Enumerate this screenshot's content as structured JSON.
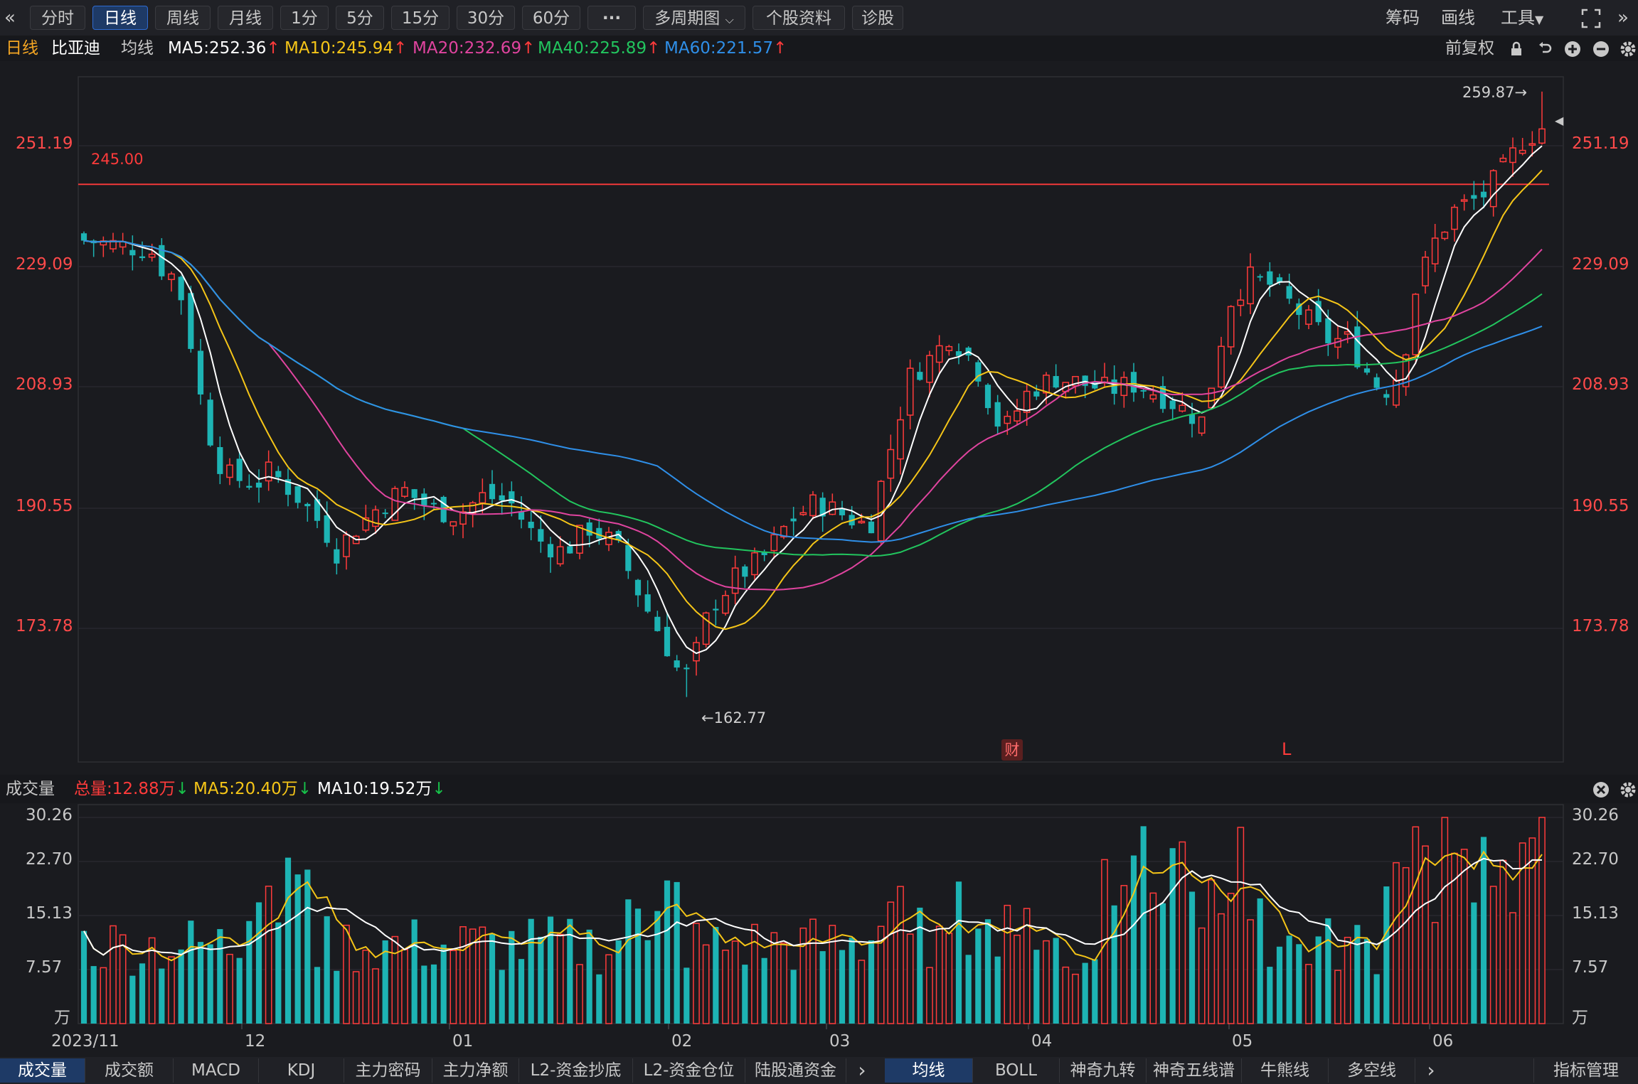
{
  "toolbar": {
    "back_icon": "«",
    "periods": [
      "分时",
      "日线",
      "周线",
      "月线",
      "1分",
      "5分",
      "15分",
      "30分",
      "60分"
    ],
    "active_period": "日线",
    "more_label": "···",
    "multi_period": "多周期图",
    "stock_info": "个股资料",
    "diagnose": "诊股",
    "chips": "筹码",
    "draw": "画线",
    "tools": "工具",
    "expand_icon": "expand-icon",
    "forward_icon": "»"
  },
  "ma_header": {
    "period_label": "日线",
    "stock_name": "比亚迪",
    "ma_label": "均线",
    "ma5": "MA5:252.36",
    "ma10": "MA10:245.94",
    "ma20": "MA20:232.69",
    "ma40": "MA40:225.89",
    "ma60": "MA60:221.57",
    "adjust": "前复权",
    "up_arrow": "↑"
  },
  "colors": {
    "ma5": "#ffffff",
    "ma10": "#f5c518",
    "ma20": "#e0449f",
    "ma40": "#22c55e",
    "ma60": "#2f8fe8",
    "up": "#ff3b3b",
    "down": "#1db4b4"
  },
  "price_axis": {
    "ticks": [
      "251.19",
      "229.09",
      "208.93",
      "190.55",
      "173.78"
    ]
  },
  "annotations": {
    "high_label": "259.87→",
    "low_label": "←162.77",
    "hline_label": "245.00",
    "cai_marker": "财",
    "l_marker": "L"
  },
  "volume_header": {
    "label": "成交量",
    "total": "总量:12.88万",
    "ma5": "MA5:20.40万",
    "ma10": "MA10:19.52万",
    "down_arrow": "↓"
  },
  "volume_axis": {
    "ticks": [
      "30.26",
      "22.70",
      "15.13",
      "7.57"
    ],
    "unit": "万"
  },
  "date_axis": {
    "labels": [
      "2023/11",
      "12",
      "01",
      "02",
      "03",
      "04",
      "05",
      "06"
    ]
  },
  "chart_data": {
    "type": "candlestick",
    "price_ticks": [
      251.19,
      229.09,
      208.93,
      190.55,
      173.78
    ],
    "high": 259.87,
    "low": 162.77,
    "hline": 245.0,
    "ma_values": {
      "MA5": 252.36,
      "MA10": 245.94,
      "MA20": 232.69,
      "MA40": 225.89,
      "MA60": 221.57
    },
    "volume_ticks": [
      30.26,
      22.7,
      15.13,
      7.57
    ],
    "volume_total": 12.88,
    "volume_ma5": 20.4,
    "volume_ma10": 19.52
  },
  "bottom_tabs_left": [
    "成交量",
    "成交额",
    "MACD",
    "KDJ",
    "主力密码",
    "主力净额",
    "L2-资金抄底",
    "L2-资金仓位",
    "陆股通资金"
  ],
  "bottom_tabs_right": [
    "均线",
    "BOLL",
    "神奇九转",
    "神奇五线谱",
    "牛熊线",
    "多空线"
  ],
  "bottom_active_left": "成交量",
  "bottom_active_right": "均线",
  "indicator_manage": "指标管理",
  "more_arrow": "›"
}
